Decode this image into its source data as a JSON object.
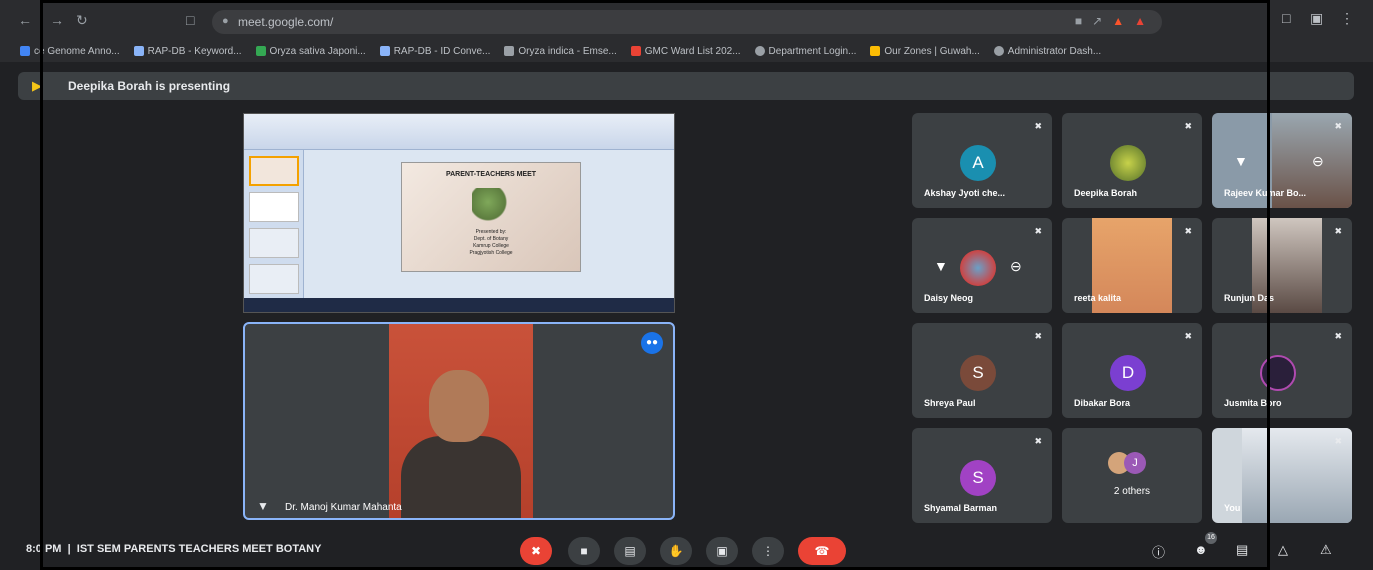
{
  "browser": {
    "url": "meet.google.com/",
    "bookmarks": [
      "ce Genome Anno...",
      "RAP-DB - Keyword...",
      "Oryza sativa Japoni...",
      "RAP-DB - ID Conve...",
      "Oryza indica - Emse...",
      "GMC Ward List 202...",
      "Department Login...",
      "Our Zones | Guwah...",
      "Administrator Dash..."
    ]
  },
  "banner": {
    "text": "Deepika Borah is presenting"
  },
  "presentation": {
    "slide_title": "PARENT-TEACHERS MEET",
    "slide_body": [
      "Presented by:",
      "Dept. of Botany",
      "Kamrup College",
      "Pragjyotish College"
    ]
  },
  "speaker": {
    "name": "Dr. Manoj Kumar Mahanta"
  },
  "participants": [
    {
      "name": "Akshay Jyoti che...",
      "initial": "A",
      "color": "#1a8fb0",
      "kind": "avatar"
    },
    {
      "name": "Deepika Borah",
      "initial": "",
      "color": "#6b8e23",
      "kind": "image"
    },
    {
      "name": "Rajeev Kumar Bo...",
      "initial": "",
      "color": "#8a9aa8",
      "kind": "video"
    },
    {
      "name": "Daisy Neog",
      "initial": "",
      "color": "#c44",
      "kind": "avatar-img"
    },
    {
      "name": "reeta kalita",
      "initial": "",
      "color": "#e39a6b",
      "kind": "video"
    },
    {
      "name": "Runjun Das",
      "initial": "",
      "color": "#5a4a44",
      "kind": "video"
    },
    {
      "name": "Shreya Paul",
      "initial": "S",
      "color": "#7a4a3a",
      "kind": "avatar"
    },
    {
      "name": "Dibakar Bora",
      "initial": "D",
      "color": "#7b3fd1",
      "kind": "avatar"
    },
    {
      "name": "Jusmita Boro",
      "initial": "",
      "color": "#3a2a5a",
      "kind": "avatar-img"
    },
    {
      "name": "Shyamal Barman",
      "initial": "S",
      "color": "#a142c4",
      "kind": "avatar"
    },
    {
      "name": "2 others",
      "initial": "J",
      "color": "#9b59b6",
      "kind": "others"
    },
    {
      "name": "You",
      "initial": "",
      "color": "#cfd6dc",
      "kind": "video"
    }
  ],
  "bottom": {
    "time": "8:",
    "time_suffix": "0 PM",
    "meeting_name": "IST SEM PARENTS TEACHERS MEET BOTANY",
    "people_count": "16"
  }
}
